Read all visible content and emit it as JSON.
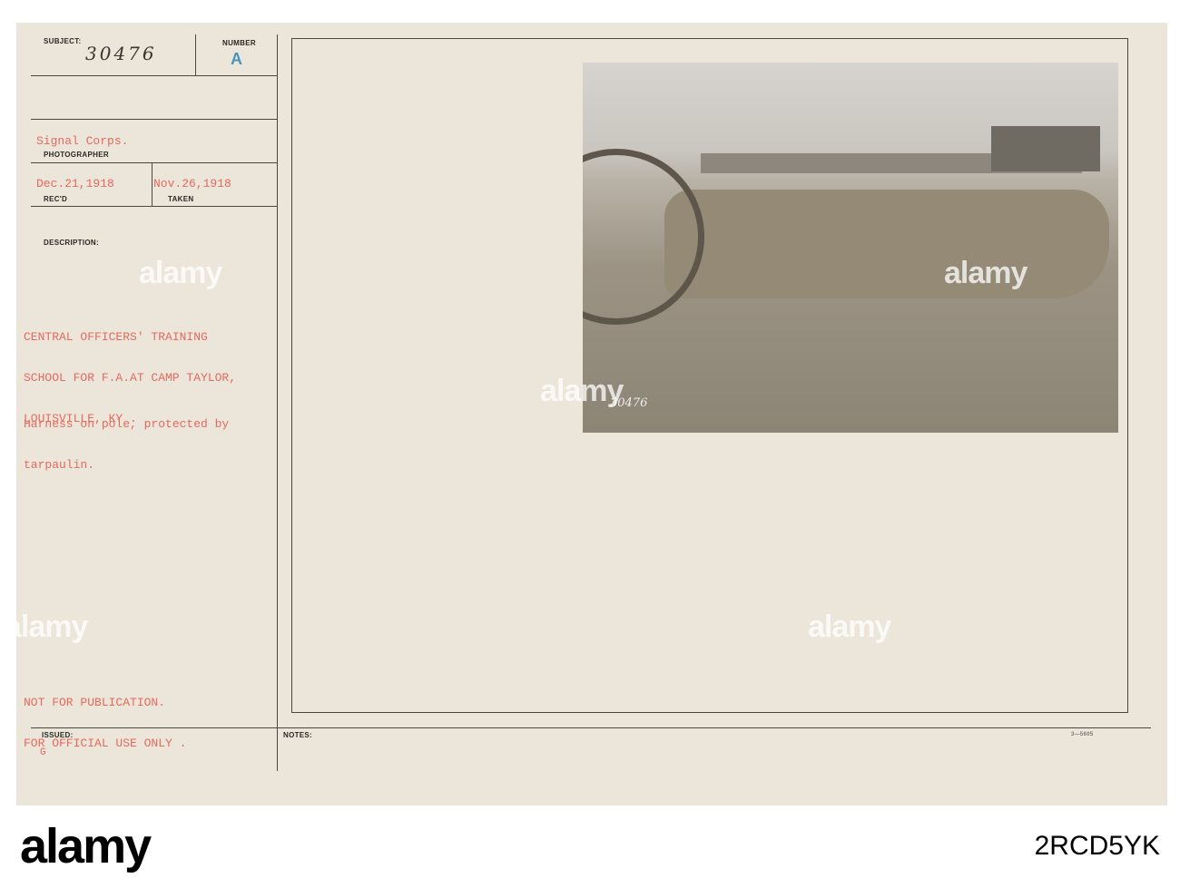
{
  "card": {
    "subject_label": "SUBJECT:",
    "subject_value": "30476",
    "number_label": "NUMBER",
    "number_value": "A",
    "photographer_value": "Signal Corps.",
    "photographer_label": "PHOTOGRAPHER",
    "recd_value": "Dec.21,1918",
    "recd_label": "REC'D",
    "taken_value": "Nov.26,1918",
    "taken_label": "TAKEN",
    "description_label": "DESCRIPTION:",
    "description_lines": [
      "CENTRAL OFFICERS' TRAINING",
      "SCHOOL FOR F.A.AT CAMP TAYLOR,",
      "LOUISVILLE, KY ."
    ],
    "caption_lines": [
      "Harness on pole, protected by",
      "tarpaulin."
    ],
    "restriction_lines": [
      "NOT FOR PUBLICATION.",
      "FOR OFFICIAL USE ONLY ."
    ],
    "issued_label": "ISSUED:",
    "issued_value": "G",
    "notes_label": "NOTES:",
    "form_number": "3—5605",
    "photo_number": "30476"
  },
  "watermark": "alamy",
  "footer": {
    "logo": "alamy",
    "image_id": "2RCD5YK"
  }
}
